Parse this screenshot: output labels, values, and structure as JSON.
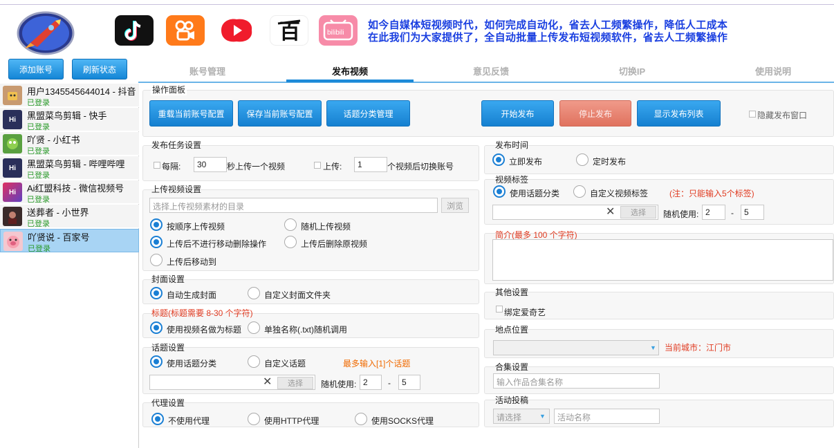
{
  "header": {
    "slogan_line1": "如今自媒体短视频时代，如何完成自动化，省去人工频繁操作，降低人工成本",
    "slogan_line2": "在此我们为大家提供了，全自动批量上传发布短视频软件，省去人工频繁操作",
    "platform_icons": [
      "rocket-logo",
      "douyin-icon",
      "kuaishou-icon",
      "xigua-icon",
      "baidu-icon",
      "bilibili-icon"
    ],
    "bilibili_text": "bilibili"
  },
  "toolbar": {
    "add_account": "添加账号",
    "refresh_status": "刷新状态"
  },
  "tabs": [
    {
      "label": "账号管理"
    },
    {
      "label": "发布视频"
    },
    {
      "label": "意见反馈"
    },
    {
      "label": "切换IP"
    },
    {
      "label": "使用说明"
    }
  ],
  "accounts": [
    {
      "name": "用户1345545644014 - 抖音",
      "status": "已登录"
    },
    {
      "name": "黑盟菜鸟剪辑 - 快手",
      "status": "已登录",
      "badge": "Hi"
    },
    {
      "name": "吖贤 - 小红书",
      "status": "已登录"
    },
    {
      "name": "黑盟菜鸟剪辑 - 哔哩哔哩",
      "status": "已登录",
      "badge": "Hi"
    },
    {
      "name": "Ai红盟科技 - 微信视频号",
      "status": "已登录",
      "badge": "Hi"
    },
    {
      "name": "送葬者 - 小世界",
      "status": "已登录"
    },
    {
      "name": "吖贤说 - 百家号",
      "status": "已登录"
    }
  ],
  "ops": {
    "title": "操作面板",
    "reload": "重载当前账号配置",
    "save": "保存当前账号配置",
    "topic_mgmt": "话题分类管理",
    "start": "开始发布",
    "stop": "停止发布",
    "show_list": "显示发布列表",
    "hide_window": "隐藏发布窗口"
  },
  "task": {
    "title": "发布任务设置",
    "every": "每隔:",
    "interval": "30",
    "interval_unit": "秒上传一个视频",
    "upload": "上传:",
    "count": "1",
    "count_unit": "个视频后切换账号"
  },
  "upload": {
    "title": "上传视频设置",
    "dir_placeholder": "选择上传视频素材的目录",
    "browse": "浏览",
    "seq": "按顺序上传视频",
    "random": "随机上传视频",
    "no_move_delete": "上传后不进行移动删除操作",
    "delete_after": "上传后删除原视频",
    "move_after": "上传后移动到"
  },
  "cover": {
    "title": "封面设置",
    "auto": "自动生成封面",
    "custom": "自定义封面文件夹"
  },
  "vtitle": {
    "title": "标题(标题需要 8-30 个字符)",
    "use_name": "使用视频名做为标题",
    "txt": "单独名称(.txt)随机调用"
  },
  "topic": {
    "title": "话题设置",
    "use_cat": "使用话题分类",
    "custom": "自定义话题",
    "max_note": "最多输入[1]个话题",
    "select": "选择",
    "rand_label": "随机使用:",
    "rand_min": "2",
    "dash": "-",
    "rand_max": "5"
  },
  "proxy": {
    "title": "代理设置",
    "none": "不使用代理",
    "http": "使用HTTP代理",
    "socks": "使用SOCKS代理"
  },
  "pubtime": {
    "title": "发布时间",
    "now": "立即发布",
    "scheduled": "定时发布"
  },
  "tags": {
    "title": "视频标签",
    "use_cat": "使用话题分类",
    "custom": "自定义视频标签",
    "note": "(注：只能输入5个标签)",
    "select": "选择",
    "rand_label": "随机使用:",
    "rand_min": "2",
    "dash": "-",
    "rand_max": "5"
  },
  "intro": {
    "title": "简介(最多 100 个字符)"
  },
  "other": {
    "title": "其他设置",
    "bind_iqiyi": "绑定爱奇艺"
  },
  "location": {
    "title": "地点位置",
    "current_city": "当前城市：江门市"
  },
  "collection": {
    "title": "合集设置",
    "placeholder": "输入作品合集名称"
  },
  "activity": {
    "title": "活动投稿",
    "select_placeholder": "请选择",
    "name_placeholder": "活动名称"
  },
  "colors": {
    "accent": "#1a7fd4",
    "slogan": "#1a3fe0",
    "warn": "#e03a20",
    "ok": "#2a9a2a"
  }
}
